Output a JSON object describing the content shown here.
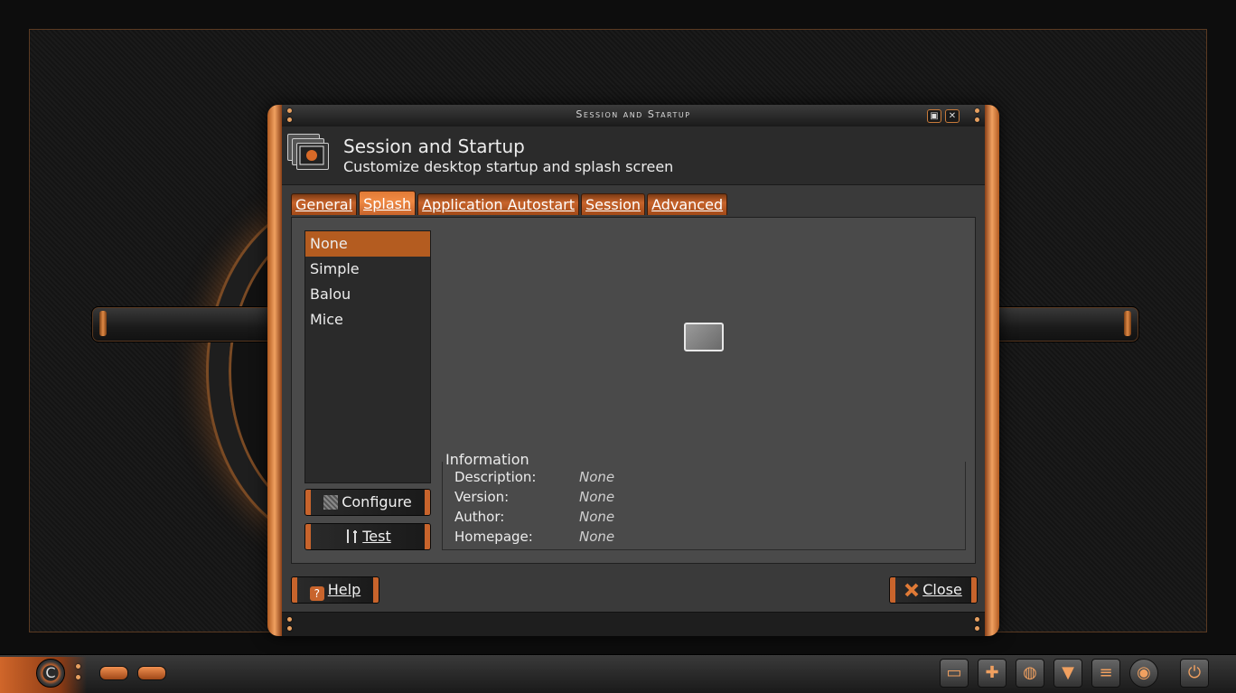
{
  "window": {
    "title": "Session and Startup",
    "maximize_glyph": "▣",
    "close_glyph": "✕"
  },
  "header": {
    "title": "Session and Startup",
    "subtitle": "Customize desktop startup and splash screen"
  },
  "tabs": [
    {
      "label": "General",
      "active": false
    },
    {
      "label": "Splash",
      "active": true
    },
    {
      "label": "Application Autostart",
      "active": false
    },
    {
      "label": "Session",
      "active": false
    },
    {
      "label": "Advanced",
      "active": false
    }
  ],
  "splash_list": {
    "items": [
      "None",
      "Simple",
      "Balou",
      "Mice"
    ],
    "selected": "None"
  },
  "buttons": {
    "configure": "Configure",
    "test": "Test",
    "help": "Help",
    "close": "Close"
  },
  "information": {
    "legend": "Information",
    "rows": [
      {
        "label": "Description:",
        "value": "None"
      },
      {
        "label": "Version:",
        "value": "None"
      },
      {
        "label": "Author:",
        "value": "None"
      },
      {
        "label": "Homepage:",
        "value": "None"
      }
    ]
  },
  "taskbar": {
    "start_glyph": "C",
    "tray": [
      {
        "icon": "folder-icon",
        "glyph": "▭"
      },
      {
        "icon": "software-box-icon",
        "glyph": "✚"
      },
      {
        "icon": "globe-icon",
        "glyph": "◍"
      },
      {
        "icon": "download-icon",
        "glyph": "▼"
      },
      {
        "icon": "document-icon",
        "glyph": "≡"
      },
      {
        "icon": "volume-knob-icon",
        "glyph": "◉"
      },
      {
        "icon": "power-icon",
        "glyph": "⏻"
      }
    ]
  },
  "colors": {
    "accent": "#c8642c",
    "selection": "#b45c20",
    "panel": "#4a4a4a"
  }
}
